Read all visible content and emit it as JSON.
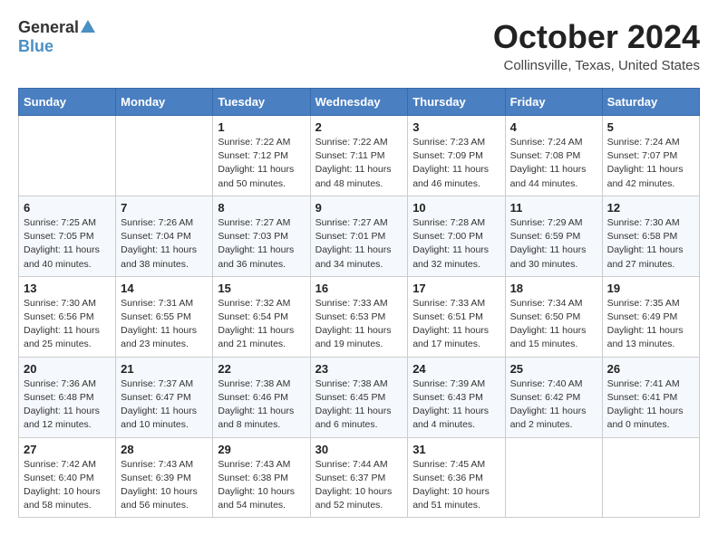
{
  "header": {
    "logo_general": "General",
    "logo_blue": "Blue",
    "month_title": "October 2024",
    "location": "Collinsville, Texas, United States"
  },
  "days_of_week": [
    "Sunday",
    "Monday",
    "Tuesday",
    "Wednesday",
    "Thursday",
    "Friday",
    "Saturday"
  ],
  "weeks": [
    [
      {
        "day": "",
        "info": ""
      },
      {
        "day": "",
        "info": ""
      },
      {
        "day": "1",
        "info": "Sunrise: 7:22 AM\nSunset: 7:12 PM\nDaylight: 11 hours and 50 minutes."
      },
      {
        "day": "2",
        "info": "Sunrise: 7:22 AM\nSunset: 7:11 PM\nDaylight: 11 hours and 48 minutes."
      },
      {
        "day": "3",
        "info": "Sunrise: 7:23 AM\nSunset: 7:09 PM\nDaylight: 11 hours and 46 minutes."
      },
      {
        "day": "4",
        "info": "Sunrise: 7:24 AM\nSunset: 7:08 PM\nDaylight: 11 hours and 44 minutes."
      },
      {
        "day": "5",
        "info": "Sunrise: 7:24 AM\nSunset: 7:07 PM\nDaylight: 11 hours and 42 minutes."
      }
    ],
    [
      {
        "day": "6",
        "info": "Sunrise: 7:25 AM\nSunset: 7:05 PM\nDaylight: 11 hours and 40 minutes."
      },
      {
        "day": "7",
        "info": "Sunrise: 7:26 AM\nSunset: 7:04 PM\nDaylight: 11 hours and 38 minutes."
      },
      {
        "day": "8",
        "info": "Sunrise: 7:27 AM\nSunset: 7:03 PM\nDaylight: 11 hours and 36 minutes."
      },
      {
        "day": "9",
        "info": "Sunrise: 7:27 AM\nSunset: 7:01 PM\nDaylight: 11 hours and 34 minutes."
      },
      {
        "day": "10",
        "info": "Sunrise: 7:28 AM\nSunset: 7:00 PM\nDaylight: 11 hours and 32 minutes."
      },
      {
        "day": "11",
        "info": "Sunrise: 7:29 AM\nSunset: 6:59 PM\nDaylight: 11 hours and 30 minutes."
      },
      {
        "day": "12",
        "info": "Sunrise: 7:30 AM\nSunset: 6:58 PM\nDaylight: 11 hours and 27 minutes."
      }
    ],
    [
      {
        "day": "13",
        "info": "Sunrise: 7:30 AM\nSunset: 6:56 PM\nDaylight: 11 hours and 25 minutes."
      },
      {
        "day": "14",
        "info": "Sunrise: 7:31 AM\nSunset: 6:55 PM\nDaylight: 11 hours and 23 minutes."
      },
      {
        "day": "15",
        "info": "Sunrise: 7:32 AM\nSunset: 6:54 PM\nDaylight: 11 hours and 21 minutes."
      },
      {
        "day": "16",
        "info": "Sunrise: 7:33 AM\nSunset: 6:53 PM\nDaylight: 11 hours and 19 minutes."
      },
      {
        "day": "17",
        "info": "Sunrise: 7:33 AM\nSunset: 6:51 PM\nDaylight: 11 hours and 17 minutes."
      },
      {
        "day": "18",
        "info": "Sunrise: 7:34 AM\nSunset: 6:50 PM\nDaylight: 11 hours and 15 minutes."
      },
      {
        "day": "19",
        "info": "Sunrise: 7:35 AM\nSunset: 6:49 PM\nDaylight: 11 hours and 13 minutes."
      }
    ],
    [
      {
        "day": "20",
        "info": "Sunrise: 7:36 AM\nSunset: 6:48 PM\nDaylight: 11 hours and 12 minutes."
      },
      {
        "day": "21",
        "info": "Sunrise: 7:37 AM\nSunset: 6:47 PM\nDaylight: 11 hours and 10 minutes."
      },
      {
        "day": "22",
        "info": "Sunrise: 7:38 AM\nSunset: 6:46 PM\nDaylight: 11 hours and 8 minutes."
      },
      {
        "day": "23",
        "info": "Sunrise: 7:38 AM\nSunset: 6:45 PM\nDaylight: 11 hours and 6 minutes."
      },
      {
        "day": "24",
        "info": "Sunrise: 7:39 AM\nSunset: 6:43 PM\nDaylight: 11 hours and 4 minutes."
      },
      {
        "day": "25",
        "info": "Sunrise: 7:40 AM\nSunset: 6:42 PM\nDaylight: 11 hours and 2 minutes."
      },
      {
        "day": "26",
        "info": "Sunrise: 7:41 AM\nSunset: 6:41 PM\nDaylight: 11 hours and 0 minutes."
      }
    ],
    [
      {
        "day": "27",
        "info": "Sunrise: 7:42 AM\nSunset: 6:40 PM\nDaylight: 10 hours and 58 minutes."
      },
      {
        "day": "28",
        "info": "Sunrise: 7:43 AM\nSunset: 6:39 PM\nDaylight: 10 hours and 56 minutes."
      },
      {
        "day": "29",
        "info": "Sunrise: 7:43 AM\nSunset: 6:38 PM\nDaylight: 10 hours and 54 minutes."
      },
      {
        "day": "30",
        "info": "Sunrise: 7:44 AM\nSunset: 6:37 PM\nDaylight: 10 hours and 52 minutes."
      },
      {
        "day": "31",
        "info": "Sunrise: 7:45 AM\nSunset: 6:36 PM\nDaylight: 10 hours and 51 minutes."
      },
      {
        "day": "",
        "info": ""
      },
      {
        "day": "",
        "info": ""
      }
    ]
  ]
}
